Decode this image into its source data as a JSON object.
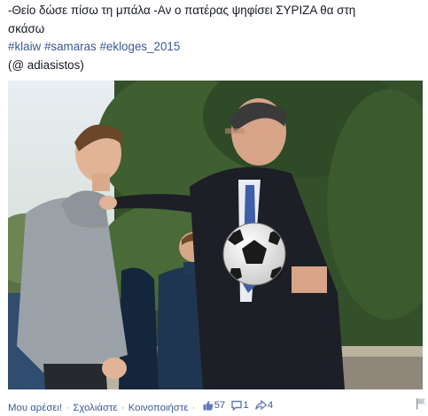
{
  "post": {
    "text_line1": "-Θείο δώσε πίσω τη μπάλα -Αν ο πατέρας ψηφίσει ΣΥΡΙΖΑ θα στη",
    "text_line2": "σκάσω",
    "hashtags": [
      "#klaiw",
      "#samaras",
      "#ekloges_2015"
    ],
    "mention": "(@ adiasistos)"
  },
  "actions": {
    "like": "Μου αρέσει!",
    "comment": "Σχολιάστε",
    "share": "Κοινοποιήστε",
    "separator": "·",
    "likes_count": "57",
    "comments_count": "1",
    "shares_count": "4"
  },
  "icons": {
    "like": "thumbs-up-icon",
    "comment": "comment-bubble-icon",
    "share": "share-arrow-icon",
    "flag": "flag-icon"
  },
  "colors": {
    "link": "#3b5998",
    "text": "#141823",
    "muted": "#9197a3"
  }
}
